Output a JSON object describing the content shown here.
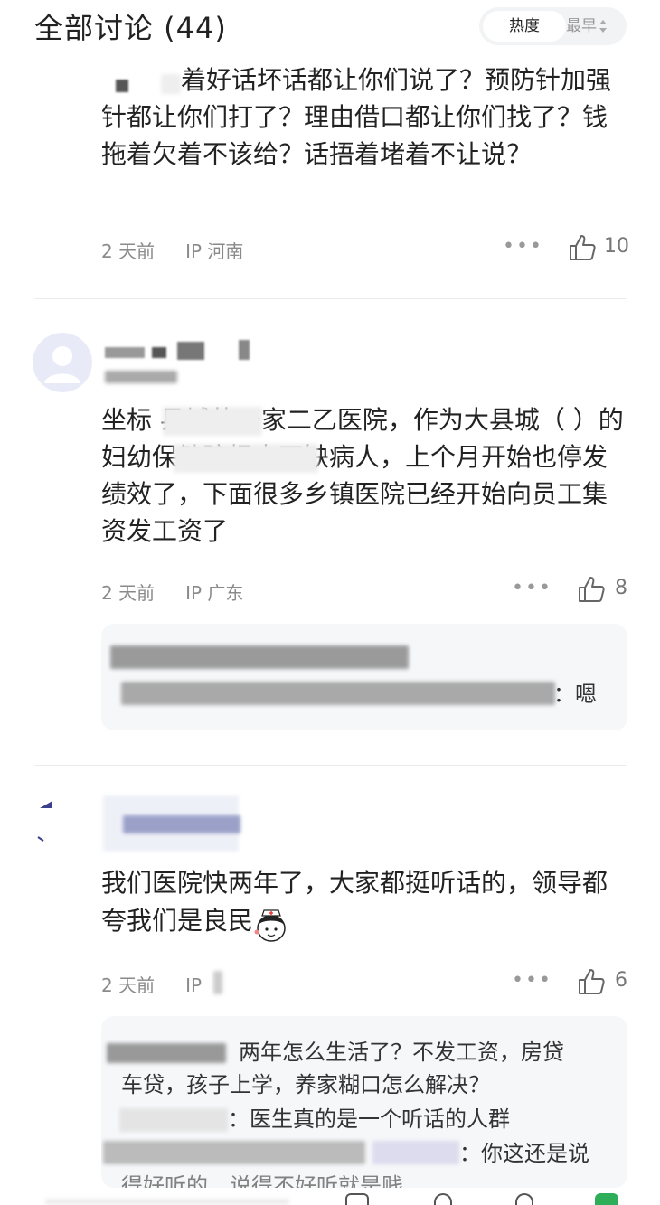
{
  "header": {
    "title": "全部讨论 (44)",
    "sort_hot": "热度",
    "sort_latest": "最早"
  },
  "comments": [
    {
      "text": "着好话坏话都让你们说了？预防针加强针都让你们打了？理由借口都让你们找了？钱拖着欠着不该给？话捂着堵着不让说？",
      "time": "2 天前",
      "ip": "IP 河南",
      "likes": "10"
    },
    {
      "text": "坐标 县城的一家二乙医院，作为大县城（ ）的妇幼保健院根本不缺病人，上个月开始也停发绩效了，下面很多乡镇医院已经开始向员工集资发工资了",
      "time": "2 天前",
      "ip": "IP 广东",
      "likes": "8",
      "reply_suffix": "：嗯"
    },
    {
      "text": "我们医院快两年了，大家都挺听话的，领导都夸我们是良民",
      "time": "2 天前",
      "ip": "IP",
      "likes": "6",
      "replies": [
        "两年怎么生活了？不发工资，房贷",
        "车贷，孩子上学，养家糊口怎么解决？",
        "：医生真的是一个听话的人群",
        "：你这还是说",
        "得好听的，说得不好听就是贱"
      ]
    }
  ],
  "icons": {
    "more": "more-dots-icon",
    "like": "thumbs-up-icon",
    "avatar": "avatar-placeholder-icon",
    "emoji": "nurse-emoji-icon"
  },
  "colors": {
    "accent": "#5b6b8c",
    "meta": "#8a8a8a",
    "reply_bg": "#f6f7f9"
  }
}
